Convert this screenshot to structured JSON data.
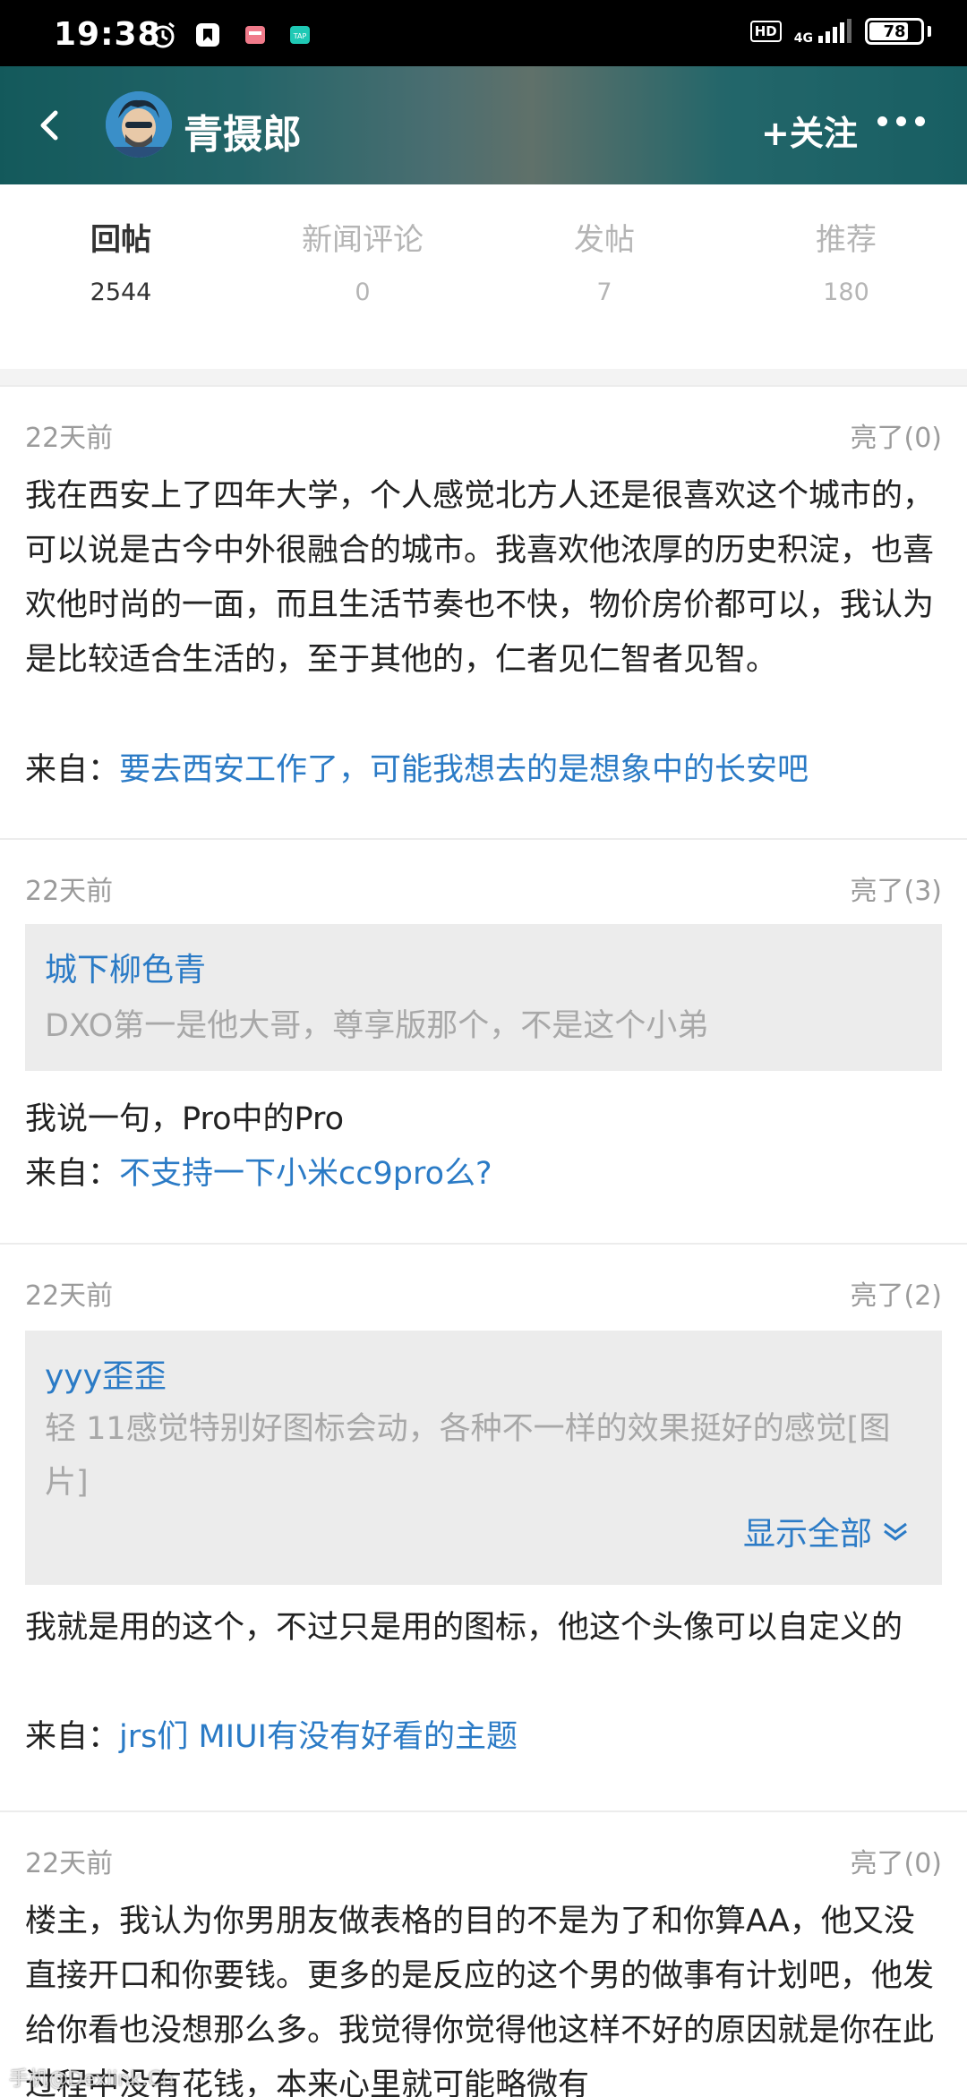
{
  "status_bar": {
    "time": "19:38",
    "hd": "HD",
    "network": "4G",
    "battery": "78",
    "battery_level": 0.78,
    "icons": [
      "alarm-icon",
      "app-icon",
      "app-icon",
      "app-icon",
      "signal-icon",
      "battery-icon"
    ]
  },
  "header": {
    "user_name": "青摄郎",
    "follow_label": "+关注",
    "icons": [
      "back-icon",
      "avatar",
      "more-icon"
    ]
  },
  "tabs": [
    {
      "label": "回帖",
      "count": "2544",
      "active": true
    },
    {
      "label": "新闻评论",
      "count": "0",
      "active": false
    },
    {
      "label": "发帖",
      "count": "7",
      "active": false
    },
    {
      "label": "推荐",
      "count": "180",
      "active": false
    }
  ],
  "posts": [
    {
      "time": "22天前",
      "likes": "亮了(0)",
      "body": "我在西安上了四年大学，个人感觉北方人还是很喜欢这个城市的，可以说是古今中外很融合的城市。我喜欢他浓厚的历史积淀，也喜欢他时尚的一面，而且生活节奏也不快，物价房价都可以，我认为是比较适合生活的，至于其他的，仁者见仁智者见智。",
      "source_prefix": "来自：",
      "source_link": "要去西安工作了，可能我想去的是想象中的长安吧"
    },
    {
      "time": "22天前",
      "likes": "亮了(3)",
      "quote_user": "城下柳色青",
      "quote_text": "DXO第一是他大哥，尊享版那个，不是这个小弟",
      "body": "我说一句，Pro中的Pro",
      "source_prefix": "来自：",
      "source_link": "不支持一下小米cc9pro么?"
    },
    {
      "time": "22天前",
      "likes": "亮了(2)",
      "quote_user": "yyy歪歪",
      "quote_text": "轻 11感觉特别好图标会动，各种不一样的效果挺好的感觉[图片]",
      "show_all": "显示全部",
      "body": "我就是用的这个，不过只是用的图标，他这个头像可以自定义的",
      "source_prefix": "来自：",
      "source_link": "jrs们 MIUI有没有好看的主题"
    },
    {
      "time": "22天前",
      "likes": "亮了(0)",
      "body": "楼主，我认为你男朋友做表格的目的不是为了和你算AA，他又没直接开口和你要钱。更多的是反应的这个男的做事有计划吧，他发给你看也没想那么多。我觉得你觉得他这样不好的原因就是你在此过程中没有花钱，本来心里就可能略微有"
    }
  ],
  "watermark": "手机@Dexlink.Cn"
}
